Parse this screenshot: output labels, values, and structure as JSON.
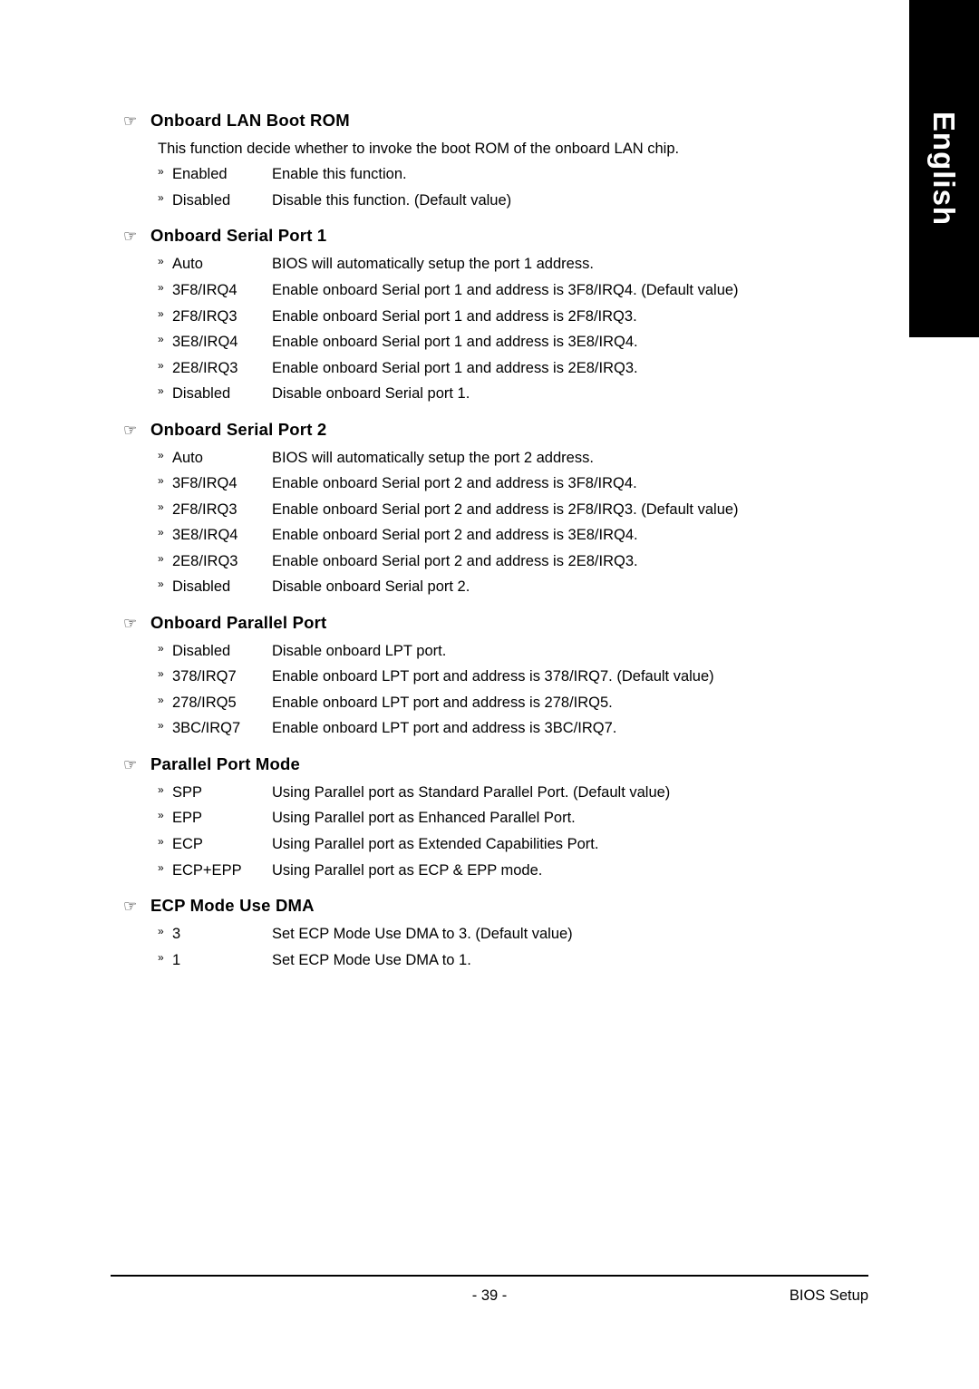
{
  "side_tab": {
    "label": "English",
    "bg_color": "#000000",
    "text_color": "#ffffff"
  },
  "glyphs": {
    "section_pointer": "☞",
    "option_arrow": "»"
  },
  "sections": [
    {
      "title": "Onboard LAN Boot ROM",
      "description": "This function decide whether to invoke the boot ROM of the onboard LAN chip.",
      "options": [
        {
          "name": "Enabled",
          "desc": "Enable this function."
        },
        {
          "name": "Disabled",
          "desc": "Disable this function. (Default value)"
        }
      ]
    },
    {
      "title": "Onboard Serial Port 1",
      "description": "",
      "options": [
        {
          "name": "Auto",
          "desc": "BIOS will automatically setup the port 1 address."
        },
        {
          "name": "3F8/IRQ4",
          "desc": "Enable onboard Serial port 1 and address is 3F8/IRQ4. (Default value)"
        },
        {
          "name": "2F8/IRQ3",
          "desc": "Enable onboard Serial port 1 and address is 2F8/IRQ3."
        },
        {
          "name": "3E8/IRQ4",
          "desc": "Enable onboard Serial port 1 and address is 3E8/IRQ4."
        },
        {
          "name": "2E8/IRQ3",
          "desc": "Enable onboard Serial port 1 and address is 2E8/IRQ3."
        },
        {
          "name": "Disabled",
          "desc": "Disable onboard Serial port 1."
        }
      ]
    },
    {
      "title": "Onboard Serial Port 2",
      "description": "",
      "options": [
        {
          "name": "Auto",
          "desc": "BIOS will automatically setup the port 2 address."
        },
        {
          "name": "3F8/IRQ4",
          "desc": "Enable onboard Serial port 2 and address is 3F8/IRQ4."
        },
        {
          "name": "2F8/IRQ3",
          "desc": "Enable onboard Serial port 2 and address is 2F8/IRQ3. (Default value)"
        },
        {
          "name": "3E8/IRQ4",
          "desc": "Enable onboard Serial port 2 and address is 3E8/IRQ4."
        },
        {
          "name": "2E8/IRQ3",
          "desc": "Enable onboard Serial port 2 and address is 2E8/IRQ3."
        },
        {
          "name": "Disabled",
          "desc": "Disable onboard Serial port 2."
        }
      ]
    },
    {
      "title": "Onboard Parallel Port",
      "description": "",
      "options": [
        {
          "name": "Disabled",
          "desc": "Disable onboard LPT port."
        },
        {
          "name": "378/IRQ7",
          "desc": "Enable onboard LPT port and address is 378/IRQ7. (Default value)"
        },
        {
          "name": "278/IRQ5",
          "desc": "Enable onboard LPT port and address is 278/IRQ5."
        },
        {
          "name": "3BC/IRQ7",
          "desc": "Enable onboard LPT port and address is 3BC/IRQ7."
        }
      ]
    },
    {
      "title": "Parallel Port Mode",
      "description": "",
      "options": [
        {
          "name": "SPP",
          "desc": "Using Parallel port as Standard Parallel Port. (Default value)"
        },
        {
          "name": "EPP",
          "desc": "Using Parallel port as Enhanced Parallel Port."
        },
        {
          "name": "ECP",
          "desc": "Using Parallel port as Extended Capabilities Port."
        },
        {
          "name": "ECP+EPP",
          "desc": "Using Parallel port as ECP & EPP mode."
        }
      ]
    },
    {
      "title": "ECP Mode Use DMA",
      "description": "",
      "options": [
        {
          "name": "3",
          "desc": "Set ECP Mode Use DMA to 3. (Default value)"
        },
        {
          "name": "1",
          "desc": "Set ECP Mode Use DMA to 1."
        }
      ]
    }
  ],
  "footer": {
    "page_number": "- 39 -",
    "right_label": "BIOS Setup"
  }
}
